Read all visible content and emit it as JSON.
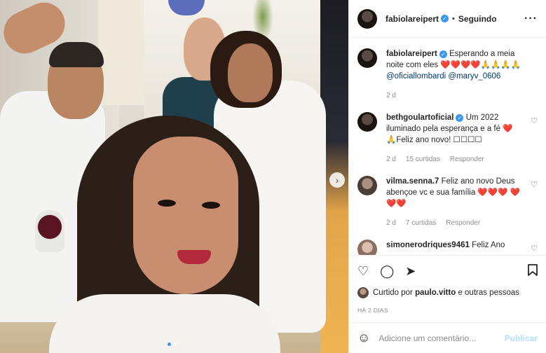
{
  "post": {
    "username": "fabiolareipert",
    "separator": "•",
    "follow_status": "Seguindo",
    "more_icon": "more-horizontal-icon",
    "carousel": {
      "current_index": 1,
      "total": 2
    }
  },
  "caption": {
    "username": "fabiolareipert",
    "text": "Esperando a meia noite com eles ❤️❤️❤️❤️🙏🙏🙏🙏",
    "mentions": "@oficiallombardi @maryv_0606",
    "time": "2 d"
  },
  "comments": [
    {
      "username": "bethgoulartoficial",
      "verified": true,
      "text": "Um 2022 iluminado pela esperança e a fé ❤️ 🙏Feliz ano novo! ☐☐☐☐",
      "time": "2 d",
      "likes": "15 curtidas",
      "reply": "Responder"
    },
    {
      "username": "vilma.senna.7",
      "verified": false,
      "text": "Feliz ano novo Deus abençoe vc e sua família ❤️❤️❤️ ❤️❤️❤️",
      "time": "2 d",
      "likes": "7 curtidas",
      "reply": "Responder"
    },
    {
      "username": "simonerodriques9461",
      "verified": false,
      "text": "Feliz Ano"
    }
  ],
  "liked_by": {
    "prefix": "Curtido por",
    "user": "paulo.vitto",
    "suffix": "e outras pessoas"
  },
  "posted": "HÁ 2 DIAS",
  "add_comment": {
    "placeholder": "Adicione um comentário...",
    "publish": "Publicar"
  },
  "colors": {
    "accent": "#3897f0",
    "heart": "#ed2f3d",
    "publish_disabled": "#b2dffc"
  }
}
